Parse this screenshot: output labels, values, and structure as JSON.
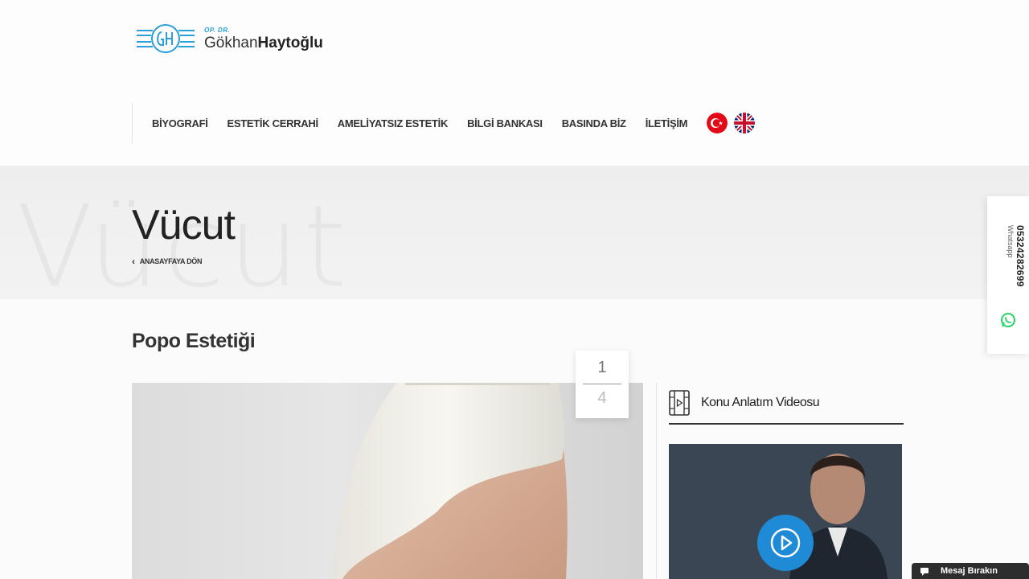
{
  "logo": {
    "prefix": "OP. DR.",
    "first_name": "Gökhan",
    "last_name": "Haytoğlu"
  },
  "nav": {
    "items": [
      {
        "label": "BİYOGRAFİ"
      },
      {
        "label": "ESTETİK CERRAHİ"
      },
      {
        "label": "AMELİYATSIZ ESTETİK"
      },
      {
        "label": "BİLGİ BANKASI"
      },
      {
        "label": "BASINDA BİZ"
      },
      {
        "label": "İLETİŞİM"
      }
    ],
    "flags": [
      "turkey-flag-icon",
      "uk-flag-icon"
    ]
  },
  "banner": {
    "title": "Vücut",
    "ghost_text": "Vücut",
    "back_label": "ANASAYFAYA DÖN"
  },
  "content": {
    "section_title": "Popo Estetiği",
    "slider": {
      "current": "1",
      "total": "4"
    },
    "video": {
      "title": "Konu Anlatım Videosu"
    }
  },
  "whatsapp": {
    "label": "Whatsapp",
    "number": "05324282699"
  },
  "message_tab": {
    "label": "Mesaj Bırakın"
  },
  "colors": {
    "accent": "#1f8ad6",
    "logo_blue": "#2a9fd8",
    "whatsapp_green": "#25d366",
    "dark": "#2d2d2d"
  }
}
